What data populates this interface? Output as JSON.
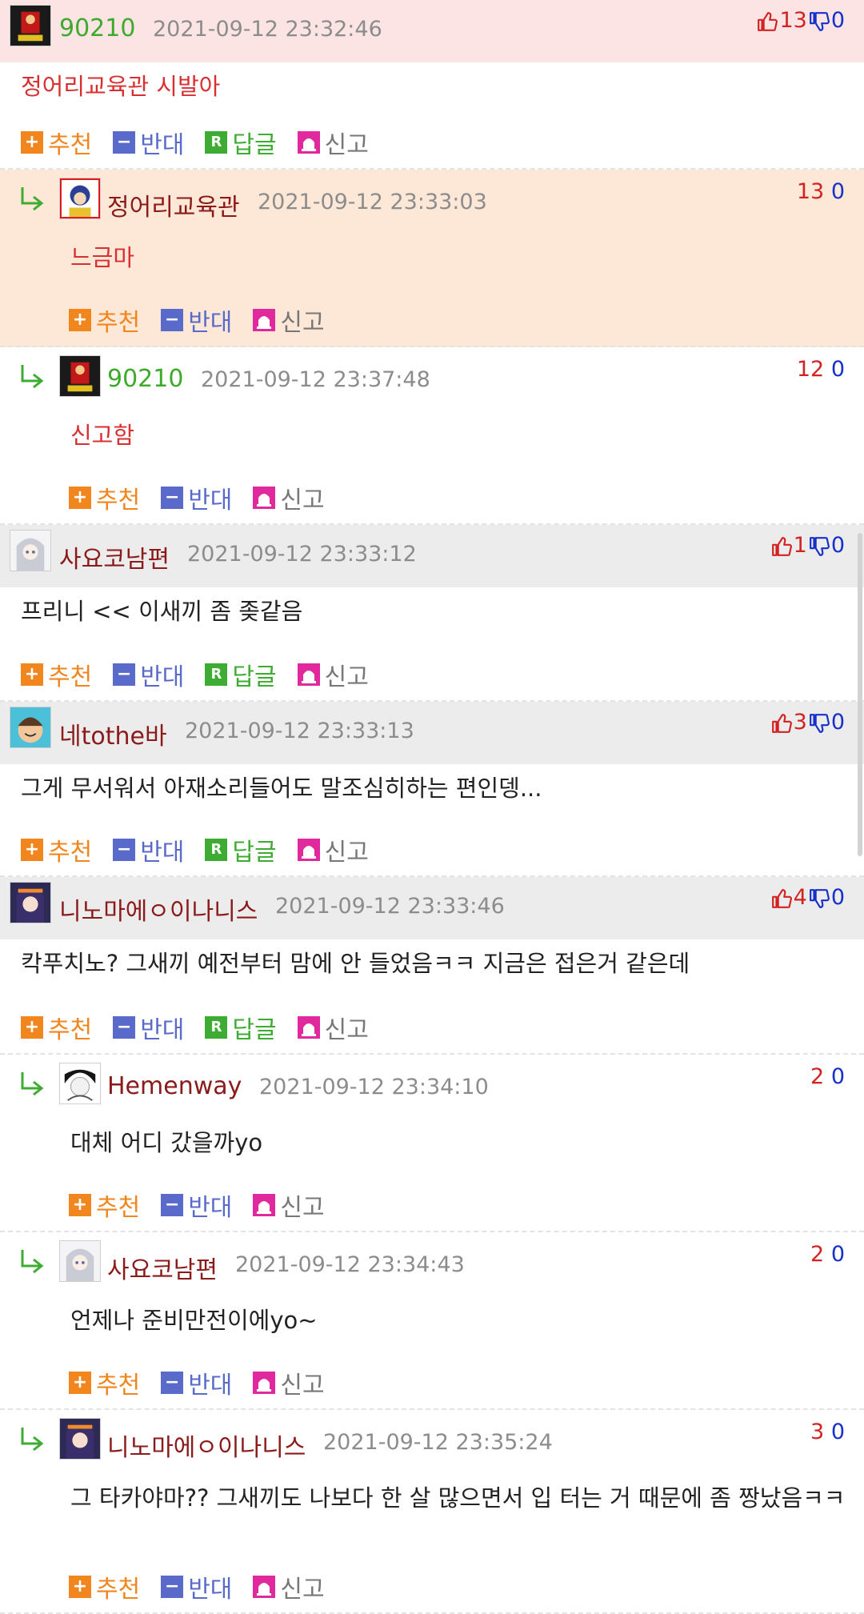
{
  "comments": [
    {
      "kind": "top",
      "height": 212,
      "bg": "pink",
      "name": "90210",
      "name_color": "#3eaa2b",
      "date": "2021-09-12 23:32:46",
      "up": "13",
      "down": "0",
      "text": "정어리교육관 시발아",
      "text_red": true,
      "avatar": "hell",
      "has_reply": true
    },
    {
      "kind": "reply",
      "height": 222,
      "bg": "orange",
      "name": "정어리교육관",
      "name_color": "#8b1a1a",
      "date": "2021-09-12 23:33:03",
      "up": "13",
      "down": "0",
      "text": "느금마",
      "text_red": true,
      "avatar": "anime-blue"
    },
    {
      "kind": "reply",
      "height": 222,
      "bg": "white",
      "name": "90210",
      "name_color": "#3eaa2b",
      "date": "2021-09-12 23:37:48",
      "up": "12",
      "down": "0",
      "text": "신고함",
      "text_red": true,
      "avatar": "hell"
    },
    {
      "kind": "top",
      "height": 221,
      "bg": "gray",
      "name": "사요코남편",
      "name_color": "#8b1a1a",
      "date": "2021-09-12 23:33:12",
      "up": "1",
      "down": "0",
      "text": "프리니 << 이새끼 좀 좆같음",
      "text_red": false,
      "avatar": "silver",
      "has_reply": true
    },
    {
      "kind": "top",
      "height": 219,
      "bg": "gray",
      "name": "네tothe바",
      "name_color": "#8b1a1a",
      "date": "2021-09-12 23:33:13",
      "up": "3",
      "down": "0",
      "text": "그게 무서워서 아재소리들어도 말조심히하는 편인뎅...",
      "text_red": false,
      "avatar": "cartoon",
      "has_reply": true
    },
    {
      "kind": "top",
      "height": 222,
      "bg": "gray",
      "name": "니노마에ㅇ이나니스",
      "name_color": "#8b1a1a",
      "date": "2021-09-12 23:33:46",
      "up": "4",
      "down": "0",
      "text": "칵푸치노? 그새끼 예전부터 맘에 안 들었음ㅋㅋ 지금은 접은거 같은데",
      "text_red": false,
      "avatar": "purple",
      "has_reply": true
    },
    {
      "kind": "reply",
      "height": 222,
      "bg": "white",
      "name": "Hemenway",
      "name_color": "#8b1a1a",
      "date": "2021-09-12 23:34:10",
      "up": "2",
      "down": "0",
      "text": "대체 어디 갔을까yo",
      "text_red": false,
      "avatar": "sketch"
    },
    {
      "kind": "reply",
      "height": 222,
      "bg": "white",
      "name": "사요코남편",
      "name_color": "#8b1a1a",
      "date": "2021-09-12 23:34:43",
      "up": "2",
      "down": "0",
      "text": "언제나 준비만전이에yo~",
      "text_red": false,
      "avatar": "silver"
    },
    {
      "kind": "reply",
      "height": 255,
      "bg": "white",
      "name": "니노마에ㅇ이나니스",
      "name_color": "#8b1a1a",
      "date": "2021-09-12 23:35:24",
      "up": "3",
      "down": "0",
      "text": "그 타카야마?? 그새끼도 나보다 한 살 많으면서 입 터는 거 때문에 좀 짱났음ㅋㅋ",
      "text_red": false,
      "avatar": "purple"
    }
  ],
  "actions": {
    "recommend": "추천",
    "oppose": "반대",
    "reply": "답글",
    "report": "신고",
    "reply_badge": "R"
  }
}
